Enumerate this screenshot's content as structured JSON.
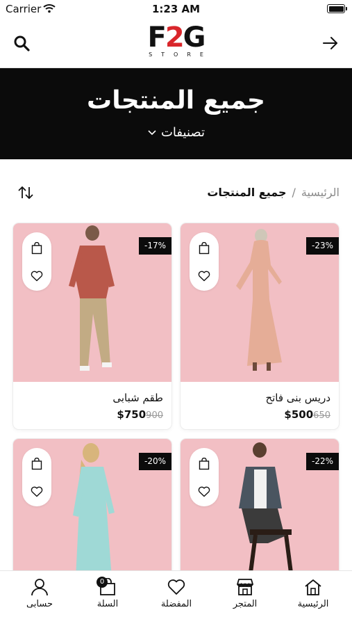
{
  "status_bar": {
    "carrier": "Carrier",
    "time": "1:23 AM"
  },
  "header": {
    "logo_main_left": "F",
    "logo_main_mid": "2",
    "logo_main_right": "G",
    "logo_sub": "STORE",
    "search_icon": "search-icon",
    "back_icon": "arrow-right-icon"
  },
  "hero": {
    "title": "جميع المنتجات",
    "categories_label": "تصنيفات"
  },
  "breadcrumb": {
    "home": "الرئيسية",
    "separator": "/",
    "current": "جميع المنتجات"
  },
  "products": [
    {
      "name": "دريس بنى فاتح",
      "price": "$500",
      "old_price": "650",
      "discount": "-23%"
    },
    {
      "name": "طقم شبابى",
      "price": "$750",
      "old_price": "900",
      "discount": "-17%"
    },
    {
      "name": "",
      "price": "",
      "old_price": "",
      "discount": "-22%"
    },
    {
      "name": "",
      "price": "",
      "old_price": "",
      "discount": "-20%"
    }
  ],
  "tabbar": {
    "home": "الرئيسية",
    "store": "المتجر",
    "favorites": "المفضلة",
    "cart": "السلة",
    "cart_count": "0",
    "account": "حسابى"
  },
  "colors": {
    "accent": "#d9262b",
    "hero_bg": "#0b0b0b",
    "card_bg": "#f2bfc4"
  }
}
